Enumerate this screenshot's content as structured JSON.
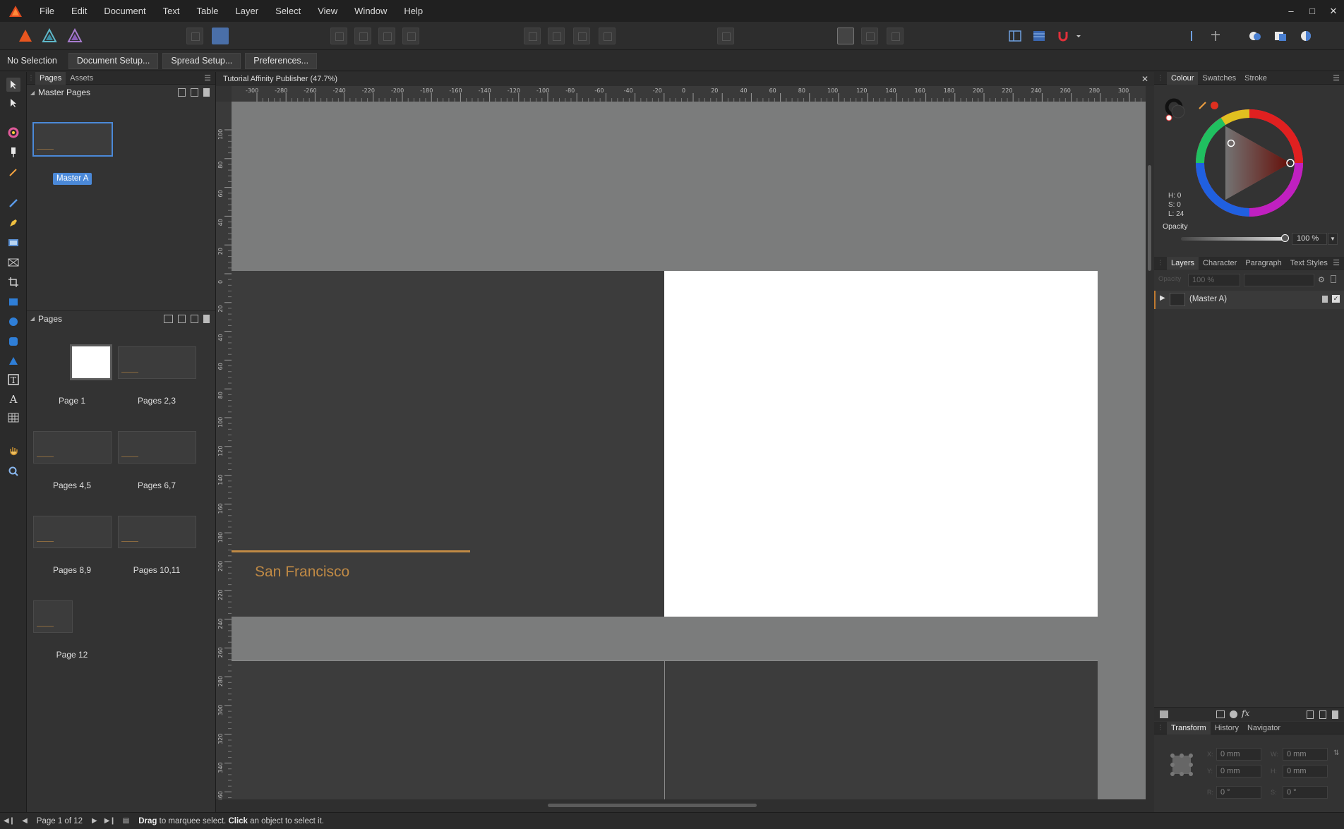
{
  "menubar": {
    "items": [
      "File",
      "Edit",
      "Document",
      "Text",
      "Table",
      "Layer",
      "Select",
      "View",
      "Window",
      "Help"
    ]
  },
  "contextbar": {
    "selection": "No Selection",
    "buttons": [
      "Document Setup...",
      "Spread Setup...",
      "Preferences..."
    ]
  },
  "pages_panel": {
    "tabs": [
      "Pages",
      "Assets"
    ],
    "master_section": "Master Pages",
    "master_label": "Master A",
    "pages_section": "Pages",
    "pages": [
      "Page 1",
      "Pages 2,3",
      "Pages 4,5",
      "Pages 6,7",
      "Pages 8,9",
      "Pages 10,11",
      "Page 12"
    ]
  },
  "document": {
    "title": "Tutorial Affinity Publisher (47.7%)",
    "spread_text": "San Francisco",
    "ruler_h": [
      "-300",
      "-280",
      "-260",
      "-240",
      "-220",
      "-200",
      "-180",
      "-160",
      "-140",
      "-120",
      "-100",
      "-80",
      "-60",
      "-40",
      "-20",
      "0",
      "20",
      "40",
      "60",
      "80",
      "100",
      "120",
      "140",
      "160",
      "180",
      "200",
      "220",
      "240",
      "260",
      "280",
      "300"
    ],
    "ruler_v": [
      "100",
      "80",
      "60",
      "40",
      "20",
      "0",
      "20",
      "40",
      "60",
      "80",
      "100",
      "120",
      "140",
      "160",
      "180",
      "200",
      "220",
      "240",
      "260",
      "280",
      "300",
      "320",
      "340",
      "360"
    ]
  },
  "colour_panel": {
    "tabs": [
      "Colour",
      "Swatches",
      "Stroke"
    ],
    "h": "H: 0",
    "s": "S: 0",
    "l": "L: 24",
    "opacity_label": "Opacity",
    "opacity_value": "100 %"
  },
  "layers_panel": {
    "tabs": [
      "Layers",
      "Character",
      "Paragraph",
      "Text Styles"
    ],
    "opacity_label": "Opacity",
    "opacity_value": "100 %",
    "layer_name": "(Master A)"
  },
  "transform_panel": {
    "tabs": [
      "Transform",
      "History",
      "Navigator"
    ],
    "x": "0 mm",
    "w": "0 mm",
    "y": "0 mm",
    "h": "0 mm",
    "r": "0 °",
    "s": "0 °",
    "x_label": "X:",
    "w_label": "W:",
    "y_label": "Y:",
    "h_label": "H:",
    "r_label": "R:",
    "s_label": "S:"
  },
  "statusbar": {
    "page_info": "Page 1 of 12",
    "hint_drag": "Drag",
    "hint_drag_text": " to marquee select. ",
    "hint_click": "Click",
    "hint_click_text": " an object to select it."
  },
  "colors": {
    "accent": "#c08a45",
    "dark_page": "#3c3c3c",
    "pasteboard": "#7b7c7c"
  }
}
